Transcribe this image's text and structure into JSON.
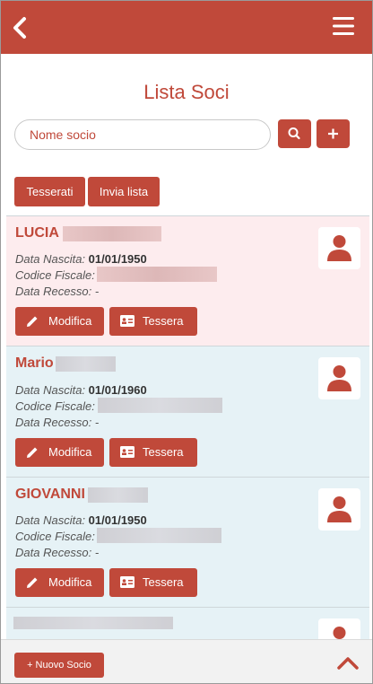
{
  "header": {
    "back_icon": "chevron-left-icon",
    "menu_icon": "hamburger-menu-icon"
  },
  "page": {
    "title": "Lista Soci"
  },
  "search": {
    "placeholder": "Nome socio",
    "value": "Nome socio"
  },
  "filters": {
    "tesserati": "Tesserati",
    "invia_lista": "Invia lista"
  },
  "labels": {
    "data_nascita": "Data Nascita:",
    "codice_fiscale": "Codice Fiscale:",
    "data_recesso": "Data Recesso:",
    "modifica": "Modifica",
    "tessera": "Tessera"
  },
  "members": [
    {
      "name": "LUCIA",
      "birth_date": "01/01/1950",
      "recesso": "-",
      "highlight": "pink"
    },
    {
      "name": "Mario",
      "birth_date": "01/01/1960",
      "recesso": "-",
      "highlight": "blue"
    },
    {
      "name": "GIOVANNI",
      "birth_date": "01/01/1950",
      "recesso": "-",
      "highlight": "blue"
    }
  ],
  "footer": {
    "new_member": "+ Nuovo Socio"
  },
  "colors": {
    "accent": "#c0493a",
    "pink_row": "#fdecee",
    "blue_row": "#e6f2f6"
  }
}
